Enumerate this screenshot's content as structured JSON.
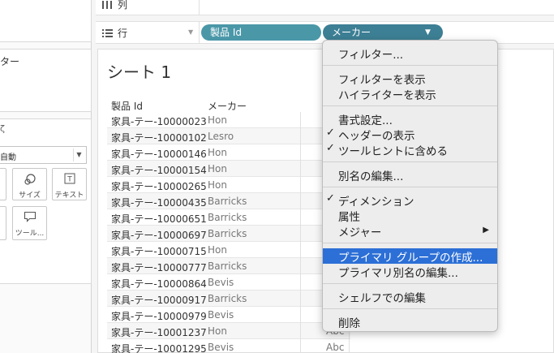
{
  "shelves": {
    "columns_label": "列",
    "rows_label": "行",
    "row_pills": [
      {
        "label": "製品 Id",
        "color": "#4a97a8"
      },
      {
        "label": "メーカー",
        "color": "#3d7f94"
      }
    ]
  },
  "left_panel": {
    "filters_label": "ター",
    "marks_fragment": "ζ",
    "mark_type": "自動",
    "buttons": [
      {
        "label": "サイズ",
        "icon": "size-icon"
      },
      {
        "label": "テキスト",
        "icon": "text-icon"
      },
      {
        "label": "ツール...",
        "icon": "tooltip-icon"
      }
    ]
  },
  "sheet": {
    "title": "シート 1",
    "headers": [
      "製品 Id",
      "メーカー"
    ],
    "rows": [
      {
        "id": "家具-テー-10000023",
        "maker": "Hon"
      },
      {
        "id": "家具-テー-10000102",
        "maker": "Lesro"
      },
      {
        "id": "家具-テー-10000146",
        "maker": "Hon"
      },
      {
        "id": "家具-テー-10000154",
        "maker": "Hon"
      },
      {
        "id": "家具-テー-10000265",
        "maker": "Hon"
      },
      {
        "id": "家具-テー-10000435",
        "maker": "Barricks"
      },
      {
        "id": "家具-テー-10000651",
        "maker": "Barricks"
      },
      {
        "id": "家具-テー-10000697",
        "maker": "Barricks"
      },
      {
        "id": "家具-テー-10000715",
        "maker": "Hon"
      },
      {
        "id": "家具-テー-10000777",
        "maker": "Barricks"
      },
      {
        "id": "家具-テー-10000864",
        "maker": "Bevis"
      },
      {
        "id": "家具-テー-10000917",
        "maker": "Barricks"
      },
      {
        "id": "家具-テー-10000979",
        "maker": "Bevis"
      },
      {
        "id": "家具-テー-10001237",
        "maker": "Hon"
      },
      {
        "id": "家具-テー-10001295",
        "maker": "Bevis"
      }
    ],
    "abc": "Abc"
  },
  "menu": {
    "items": [
      {
        "label": "フィルター...",
        "checked": false
      },
      {
        "label": "フィルターを表示",
        "checked": false
      },
      {
        "label": "ハイライターを表示",
        "checked": false
      },
      {
        "label": "書式設定...",
        "checked": false
      },
      {
        "label": "ヘッダーの表示",
        "checked": true
      },
      {
        "label": "ツールヒントに含める",
        "checked": true
      },
      {
        "label": "別名の編集...",
        "checked": false
      },
      {
        "label": "ディメンション",
        "checked": true
      },
      {
        "label": "属性",
        "checked": false
      },
      {
        "label": "メジャー",
        "checked": false,
        "submenu": true
      },
      {
        "label": "プライマリ グループの作成...",
        "checked": false,
        "highlighted": true
      },
      {
        "label": "プライマリ別名の編集...",
        "checked": false
      },
      {
        "label": "シェルフでの編集",
        "checked": false
      },
      {
        "label": "削除",
        "checked": false
      }
    ],
    "highlight_color": "#2c6fd6"
  }
}
